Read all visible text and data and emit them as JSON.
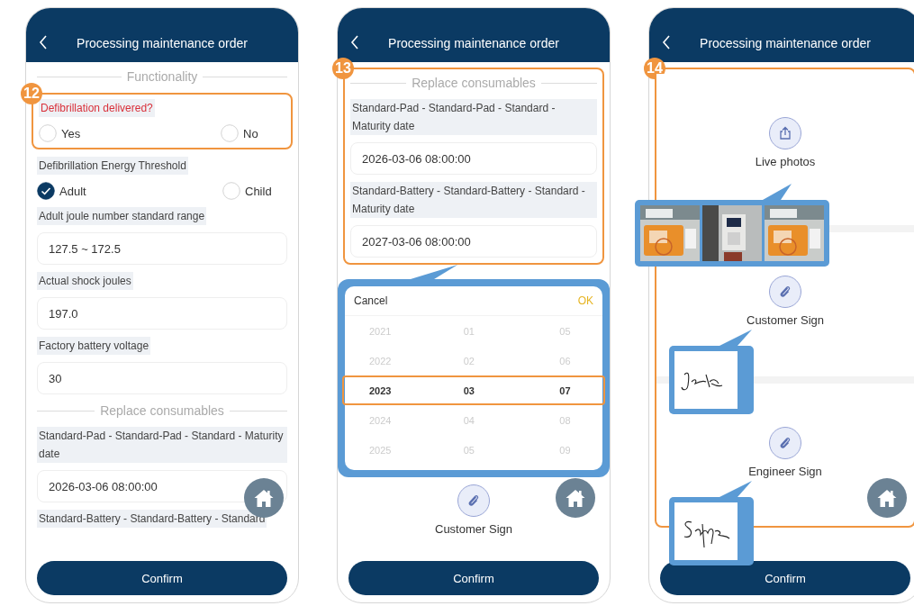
{
  "screens": [
    {
      "title": "Processing maintenance order",
      "home_button": true,
      "confirm": "Confirm",
      "items": [
        {
          "kind": "divider",
          "label": "Functionality"
        },
        {
          "kind": "group",
          "callout": "12",
          "children": [
            {
              "kind": "radio",
              "label": "Defibrillation delivered?",
              "required": true,
              "options": [
                {
                  "label": "Yes",
                  "selected": false
                },
                {
                  "label": "No",
                  "selected": false
                }
              ]
            }
          ]
        },
        {
          "kind": "radio",
          "label": "Defibrillation Energy Threshold",
          "required": false,
          "options": [
            {
              "label": "Adult",
              "selected": true
            },
            {
              "label": "Child",
              "selected": false
            }
          ]
        },
        {
          "kind": "field",
          "label": "Adult joule number standard range",
          "value": "127.5 ~ 172.5"
        },
        {
          "kind": "field",
          "label": "Actual shock joules",
          "value": "197.0"
        },
        {
          "kind": "field",
          "label": "Factory battery voltage",
          "value": "30"
        },
        {
          "kind": "divider",
          "label": "Replace consumables"
        },
        {
          "kind": "field",
          "label": "Standard-Pad - Standard-Pad - Standard - Maturity date",
          "value": "2026-03-06 08:00:00"
        },
        {
          "kind": "label",
          "label": "Standard-Battery - Standard-Battery - Standard"
        }
      ]
    },
    {
      "title": "Processing maintenance order",
      "home_button": true,
      "confirm": "Confirm",
      "items": [
        {
          "kind": "group",
          "callout": "13",
          "children": [
            {
              "kind": "divider",
              "label": "Replace consumables"
            },
            {
              "kind": "field",
              "label": "Standard-Pad - Standard-Pad - Standard - Maturity date",
              "value": "2026-03-06 08:00:00"
            },
            {
              "kind": "field",
              "label": "Standard-Battery - Standard-Battery - Standard - Maturity date",
              "value": "2027-03-06 08:00:00"
            }
          ]
        },
        {
          "kind": "picker",
          "cancel": "Cancel",
          "ok": "OK",
          "rows": [
            {
              "values": [
                "2021",
                "01",
                "05"
              ],
              "selected": false
            },
            {
              "values": [
                "2022",
                "02",
                "06"
              ],
              "selected": false
            },
            {
              "values": [
                "2023",
                "03",
                "07"
              ],
              "selected": true
            },
            {
              "values": [
                "2024",
                "04",
                "08"
              ],
              "selected": false
            },
            {
              "values": [
                "2025",
                "05",
                "09"
              ],
              "selected": false
            }
          ]
        },
        {
          "kind": "sign_upload",
          "label": "Customer Sign"
        }
      ]
    },
    {
      "title": "Processing maintenance order",
      "home_button": true,
      "confirm": "Confirm",
      "items": [
        {
          "kind": "group",
          "callout": "14",
          "children": [
            {
              "kind": "photo_upload",
              "label": "Live photos"
            },
            {
              "kind": "sign_upload",
              "label": "Customer Sign",
              "attachments": [
                {
                  "kind": "signature"
                }
              ]
            },
            {
              "kind": "sign_upload",
              "label": "Engineer Sign",
              "attachments": [
                {
                  "kind": "signature"
                }
              ]
            }
          ]
        }
      ]
    }
  ]
}
